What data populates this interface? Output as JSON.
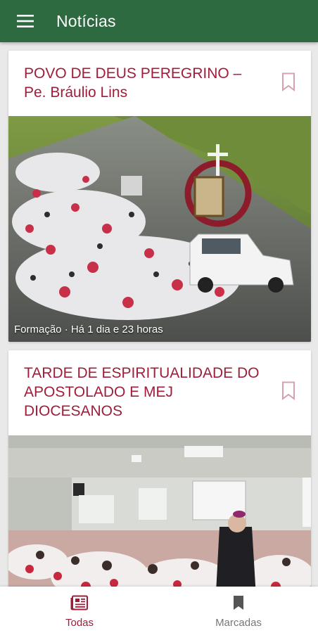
{
  "appbar": {
    "title": "Notícias",
    "menu_icon": "hamburger-menu-icon",
    "color": "#2d6a3f"
  },
  "accent_color": "#a01d3a",
  "posts": [
    {
      "title": "POVO DE DEUS PEREGRINO – Pe. Bráulio Lins",
      "meta": "Formação · Há 1 dia e 23 horas",
      "image": "pilgrimage-crowd-photo",
      "bookmark_icon": "bookmark-outline-icon"
    },
    {
      "title": "TARDE DE ESPIRITUALIDADE DO APOSTOLADO E MEJ DIOCESANOS",
      "meta": "",
      "image": "church-hall-gathering-photo",
      "bookmark_icon": "bookmark-outline-icon"
    }
  ],
  "bottom_nav": {
    "items": [
      {
        "label": "Todas",
        "icon": "newspaper-icon",
        "active": true
      },
      {
        "label": "Marcadas",
        "icon": "bookmark-filled-icon",
        "active": false
      }
    ]
  }
}
